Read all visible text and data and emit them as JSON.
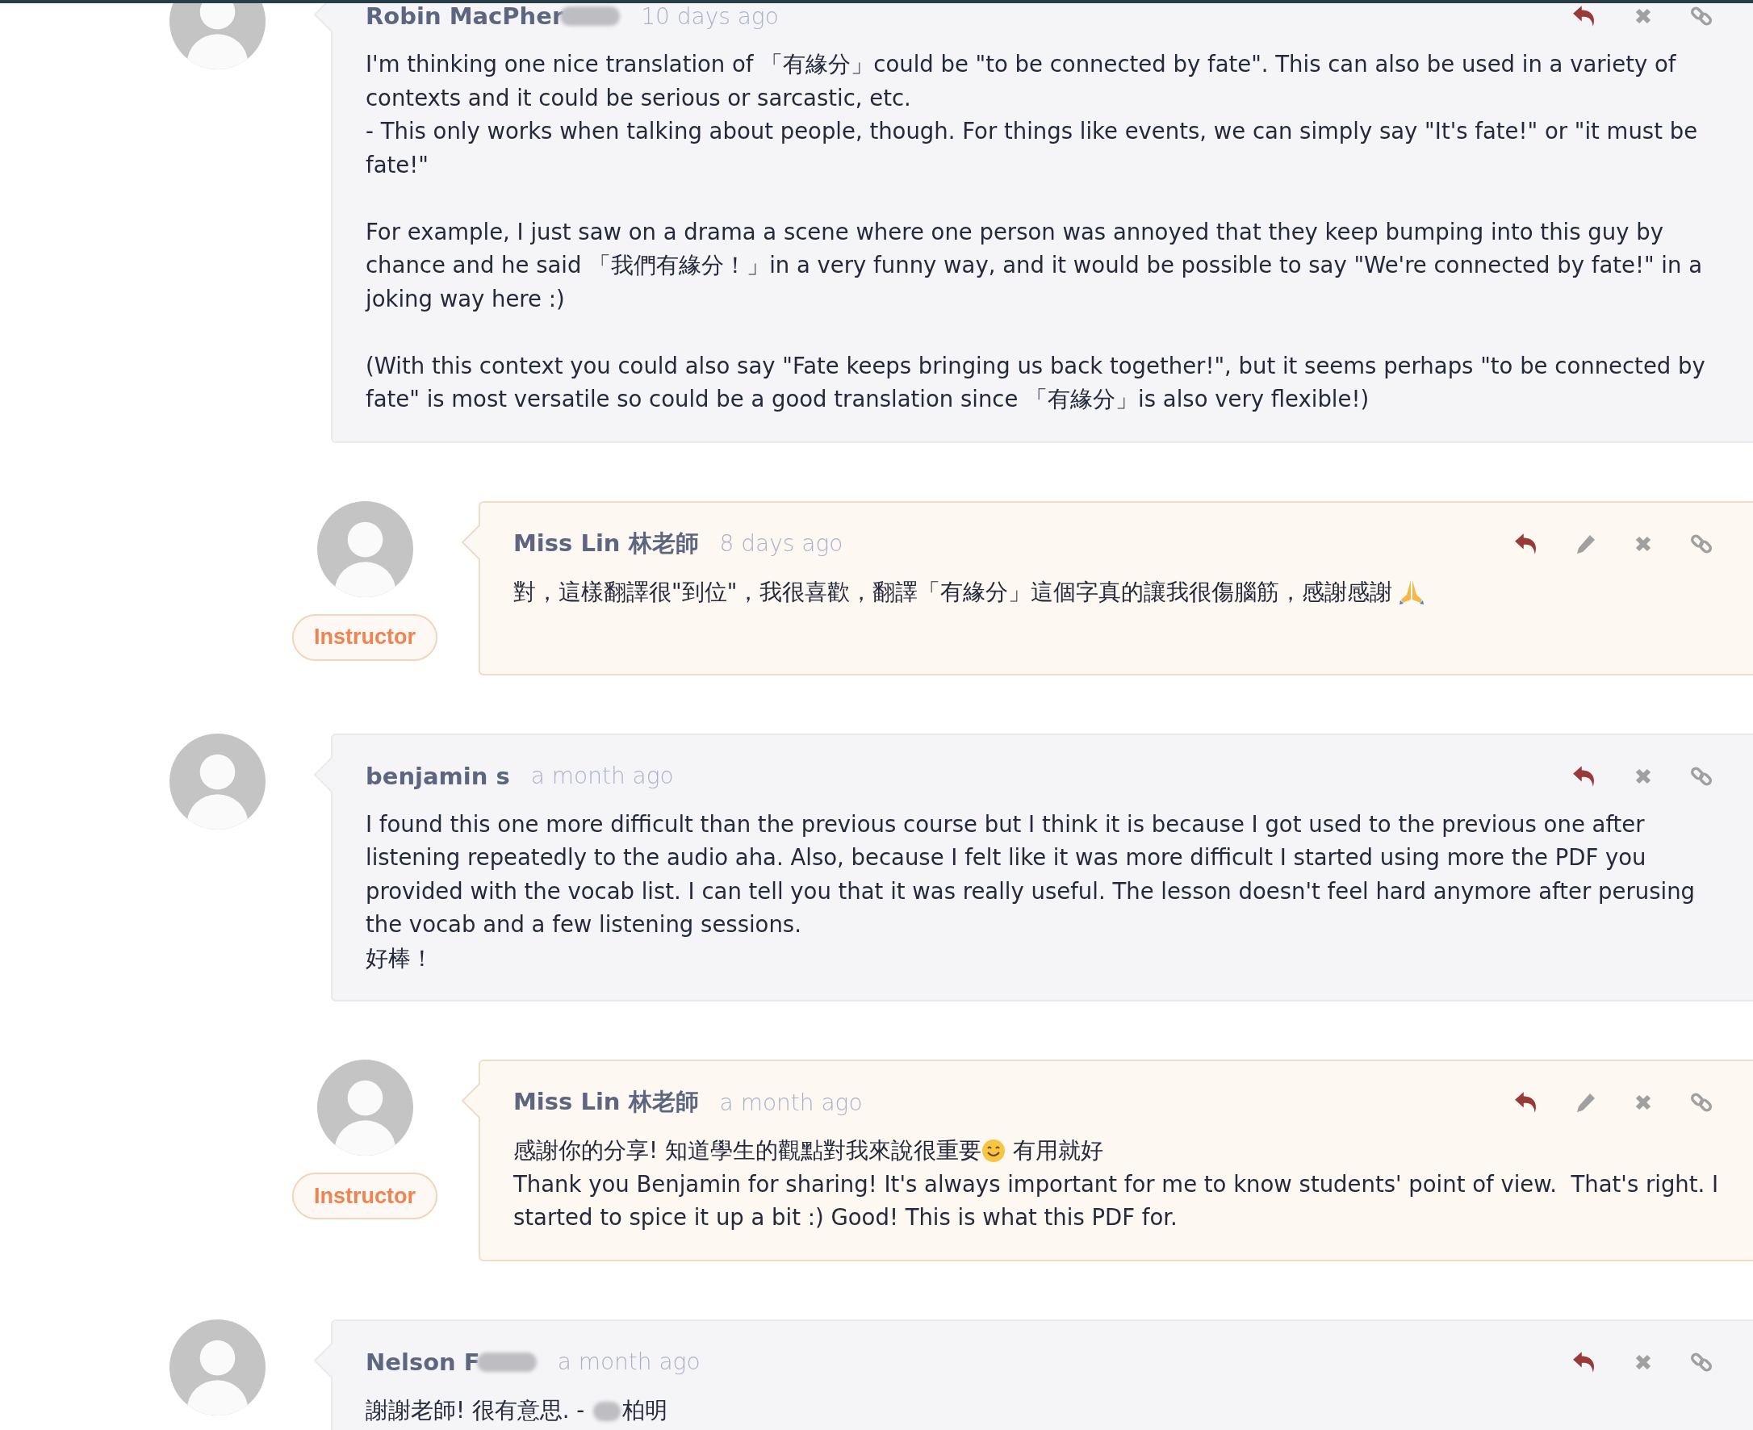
{
  "comments": [
    {
      "kind": "user",
      "nested": false,
      "name": "Robin MacPher",
      "name_redacted": true,
      "time": "10 days ago",
      "editable": false,
      "paragraphs": [
        [
          "I'm thinking one nice translation of 「有緣分」could be \"to be connected by fate\". This can also be used in a variety of contexts and it could be serious or sarcastic, etc.",
          "- This only works when talking about people, though. For things like events, we can simply say \"It's fate!\" or \"it must be fate!\""
        ],
        [
          "For example, I just saw on a drama a scene where one person was annoyed that they keep bumping into this guy by chance and he said 「我們有緣分！」in a very funny way, and it would be possible to say \"We're connected by fate!\" in a joking way here :)"
        ],
        [
          "(With this context you could also say \"Fate keeps bringing us back together!\", but it seems perhaps \"to be connected by fate\" is most versatile so could be a good translation since 「有緣分」is also very flexible!)"
        ]
      ]
    },
    {
      "kind": "instructor",
      "nested": true,
      "badge": "Instructor",
      "name": "Miss Lin 林老師",
      "name_redacted": false,
      "time": "8 days ago",
      "editable": true,
      "paragraphs": [
        [
          [
            {
              "kind": "text",
              "text": "對，這樣翻譯很\"到位\"，我很喜歡，翻譯「有緣分」這個字真的讓我很傷腦筋，感謝感謝 "
            },
            {
              "kind": "pray"
            }
          ]
        ]
      ]
    },
    {
      "kind": "user",
      "nested": false,
      "name": "benjamin s",
      "name_redacted": false,
      "time": "a month ago",
      "editable": false,
      "paragraphs": [
        [
          "I found this one more difficult than the previous course but I think it is because I got used to the previous one after listening repeatedly to the audio aha. Also, because I felt like it was more difficult I started using more the PDF you provided with the vocab list. I can tell you that it was really useful. The lesson doesn't feel hard anymore after perusing the vocab and a few listening sessions.",
          "好棒！"
        ]
      ]
    },
    {
      "kind": "instructor",
      "nested": true,
      "badge": "Instructor",
      "name": "Miss Lin 林老師",
      "name_redacted": false,
      "time": "a month ago",
      "editable": true,
      "paragraphs": [
        [
          [
            {
              "kind": "text",
              "text": "感謝你的分享! 知道學生的觀點對我來說很重要"
            },
            {
              "kind": "smile"
            },
            {
              "kind": "text",
              "text": " 有用就好"
            }
          ],
          "Thank you Benjamin for sharing! It's always important for me to know students' point of view.  That's right. I started to spice it up a bit :) Good! This is what this PDF for."
        ]
      ]
    },
    {
      "kind": "user",
      "nested": false,
      "name": "Nelson F",
      "name_redacted": true,
      "time": "a month ago",
      "editable": false,
      "paragraphs": [
        [
          [
            {
              "kind": "text",
              "text": "謝謝老師! 很有意思. - "
            },
            {
              "kind": "redacted"
            },
            {
              "kind": "text",
              "text": "柏明"
            }
          ]
        ]
      ]
    }
  ]
}
